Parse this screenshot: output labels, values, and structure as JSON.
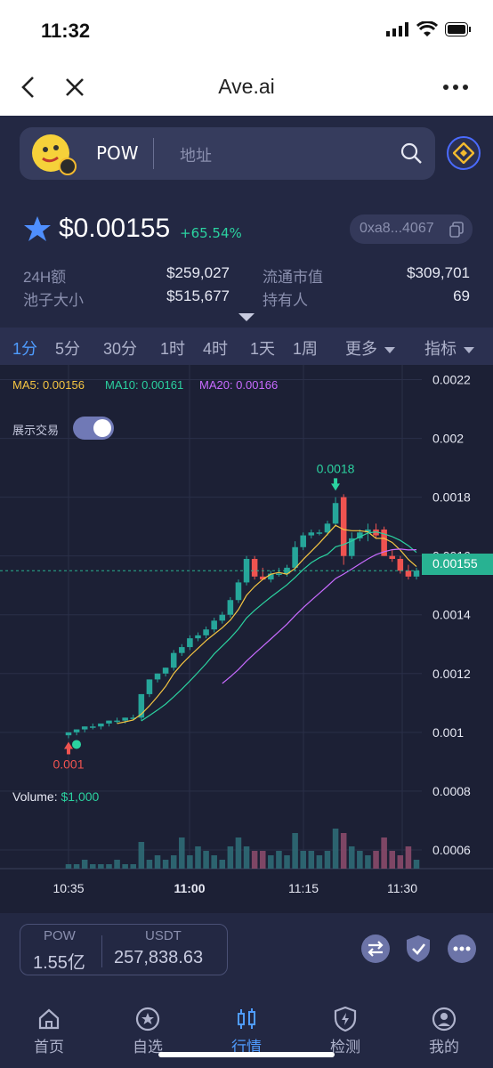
{
  "status_bar": {
    "time": "11:32"
  },
  "browser": {
    "title": "Ave.ai"
  },
  "search": {
    "token_symbol": "POW",
    "placeholder": "地址"
  },
  "token": {
    "price": "$0.00155",
    "change": "+65.54%",
    "address": "0xa8...4067",
    "stats": {
      "vol_24h_label": "24H额",
      "vol_24h_value": "$259,027",
      "mcap_label": "流通市值",
      "mcap_value": "$309,701",
      "pool_label": "池子大小",
      "pool_value": "$515,677",
      "holders_label": "持有人",
      "holders_value": "69"
    }
  },
  "timeframes": [
    "1分",
    "5分",
    "30分",
    "1时",
    "4时",
    "1天",
    "1周"
  ],
  "active_timeframe": "1分",
  "more_label": "更多",
  "indicator_label": "指标",
  "legend": {
    "ma5": "MA5: 0.00156",
    "ma10": "MA10: 0.00161",
    "ma20": "MA20: 0.00166"
  },
  "show_trades_label": "展示交易",
  "volume_label": "Volume:",
  "volume_value": "$1,000",
  "colors": {
    "up": "#26a69a",
    "down": "#ef5350",
    "ma5": "#f5c542",
    "ma10": "#2bd2a0",
    "ma20": "#c86bff",
    "accent": "#4f9cff"
  },
  "chart_data": {
    "type": "candlestick",
    "y_ticks": [
      "0.0022",
      "0.002",
      "0.0018",
      "0.0016",
      "0.0014",
      "0.0012",
      "0.001",
      "0.0008",
      "0.0006"
    ],
    "x_ticks": [
      "10:35",
      "11:00",
      "11:15",
      "11:30"
    ],
    "ylim": [
      0.0005,
      0.00225
    ],
    "current_price": "0.00155",
    "high_marker": "0.0018",
    "low_marker": "0.001",
    "candles": [
      [
        0.00099,
        0.001,
        0.00098,
        0.001
      ],
      [
        0.001,
        0.00101,
        0.00099,
        0.00101
      ],
      [
        0.00101,
        0.00102,
        0.001,
        0.00102
      ],
      [
        0.00102,
        0.00103,
        0.00101,
        0.00102
      ],
      [
        0.00102,
        0.00103,
        0.00101,
        0.00103
      ],
      [
        0.00103,
        0.00104,
        0.00102,
        0.00104
      ],
      [
        0.00104,
        0.00105,
        0.00103,
        0.00104
      ],
      [
        0.00104,
        0.00105,
        0.00103,
        0.00105
      ],
      [
        0.00105,
        0.00106,
        0.00104,
        0.00105
      ],
      [
        0.00105,
        0.00113,
        0.00104,
        0.00113
      ],
      [
        0.00113,
        0.00118,
        0.00112,
        0.00118
      ],
      [
        0.00118,
        0.0012,
        0.00117,
        0.0012
      ],
      [
        0.0012,
        0.00122,
        0.00119,
        0.00122
      ],
      [
        0.00122,
        0.00128,
        0.00121,
        0.00127
      ],
      [
        0.00127,
        0.0013,
        0.00126,
        0.00129
      ],
      [
        0.00129,
        0.00133,
        0.00128,
        0.00132
      ],
      [
        0.00132,
        0.00134,
        0.00131,
        0.00133
      ],
      [
        0.00133,
        0.00136,
        0.00132,
        0.00135
      ],
      [
        0.00135,
        0.00139,
        0.00134,
        0.00138
      ],
      [
        0.00138,
        0.00141,
        0.00137,
        0.0014
      ],
      [
        0.0014,
        0.00146,
        0.00139,
        0.00145
      ],
      [
        0.00145,
        0.00152,
        0.00144,
        0.00151
      ],
      [
        0.00151,
        0.0016,
        0.0015,
        0.00159
      ],
      [
        0.00159,
        0.0016,
        0.00152,
        0.00153
      ],
      [
        0.00153,
        0.00156,
        0.00152,
        0.00152
      ],
      [
        0.00152,
        0.00155,
        0.00151,
        0.00154
      ],
      [
        0.00154,
        0.00156,
        0.00153,
        0.00154
      ],
      [
        0.00154,
        0.00157,
        0.00153,
        0.00156
      ],
      [
        0.00156,
        0.00165,
        0.00155,
        0.00163
      ],
      [
        0.00163,
        0.00168,
        0.00162,
        0.00167
      ],
      [
        0.00167,
        0.00169,
        0.00166,
        0.00168
      ],
      [
        0.00168,
        0.00169,
        0.00167,
        0.00168
      ],
      [
        0.00168,
        0.00172,
        0.00167,
        0.00171
      ],
      [
        0.00171,
        0.0018,
        0.0017,
        0.00178
      ],
      [
        0.0018,
        0.00181,
        0.00157,
        0.0016
      ],
      [
        0.0016,
        0.00168,
        0.00159,
        0.00166
      ],
      [
        0.00166,
        0.00169,
        0.00165,
        0.00168
      ],
      [
        0.00168,
        0.00171,
        0.00165,
        0.00169
      ],
      [
        0.00169,
        0.00171,
        0.00166,
        0.00167
      ],
      [
        0.00169,
        0.0017,
        0.0016,
        0.0016
      ],
      [
        0.0016,
        0.00162,
        0.00158,
        0.00159
      ],
      [
        0.00159,
        0.0016,
        0.00154,
        0.00155
      ],
      [
        0.00155,
        0.00157,
        0.00152,
        0.00153
      ],
      [
        0.00153,
        0.00156,
        0.00152,
        0.00155
      ]
    ],
    "volumes": [
      1,
      1,
      2,
      1,
      1,
      1,
      2,
      1,
      1,
      6,
      2,
      3,
      2,
      3,
      7,
      3,
      5,
      4,
      3,
      2,
      5,
      7,
      5,
      4,
      4,
      3,
      4,
      3,
      8,
      4,
      4,
      3,
      4,
      9,
      8,
      5,
      4,
      3,
      4,
      7,
      4,
      3,
      5,
      2
    ]
  },
  "bottom_info": {
    "token_label": "POW",
    "token_amount": "1.55亿",
    "quote_label": "USDT",
    "quote_amount": "257,838.63"
  },
  "nav": [
    {
      "label": "首页",
      "icon": "home-icon"
    },
    {
      "label": "自选",
      "icon": "star-circle-icon"
    },
    {
      "label": "行情",
      "icon": "candle-icon"
    },
    {
      "label": "检测",
      "icon": "shield-lightning-icon"
    },
    {
      "label": "我的",
      "icon": "user-icon"
    }
  ]
}
